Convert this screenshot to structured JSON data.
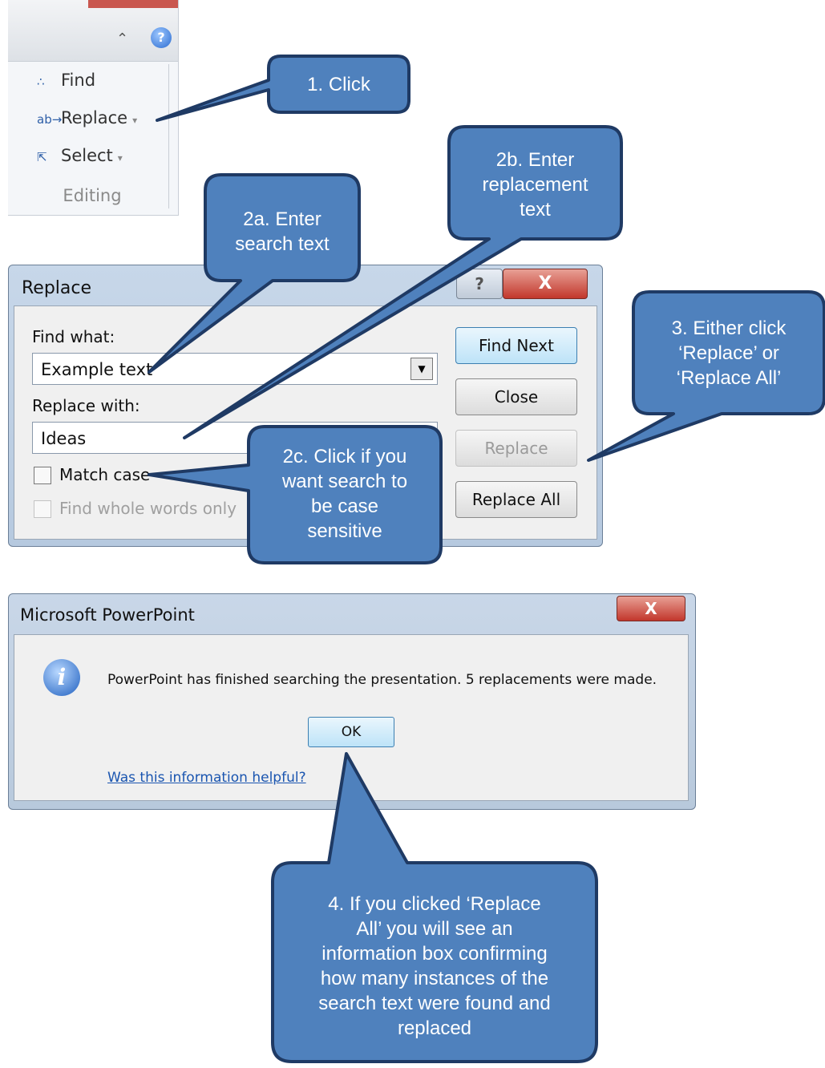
{
  "ribbon": {
    "help_icon": "?",
    "items": [
      {
        "label": "Find",
        "icon": "binoculars-icon",
        "glyph": "∴"
      },
      {
        "label": "Replace",
        "icon": "replace-icon",
        "glyph": "ab→",
        "dropdown": "▾"
      },
      {
        "label": "Select",
        "icon": "cursor-icon",
        "glyph": "⇱",
        "dropdown": "▾"
      }
    ],
    "group_label": "Editing"
  },
  "replace_dialog": {
    "title": "Replace",
    "help_button": "?",
    "close_button": "X",
    "find_what_label": "Find what:",
    "find_what_value": "Example text",
    "replace_with_label": "Replace with:",
    "replace_with_value": "Ideas",
    "match_case_label": "Match case",
    "whole_words_label": "Find whole words only",
    "buttons": {
      "find_next": "Find Next",
      "close": "Close",
      "replace": "Replace",
      "replace_all": "Replace All"
    }
  },
  "message_box": {
    "title": "Microsoft PowerPoint",
    "close_button": "X",
    "info_icon": "i",
    "message": "PowerPoint has finished searching the presentation. 5 replacements were made.",
    "ok_button": "OK",
    "help_link": "Was this information helpful?"
  },
  "callouts": {
    "c1": "1. Click",
    "c2a_line1": "2a. Enter",
    "c2a_line2": "search text",
    "c2b_line1": "2b. Enter",
    "c2b_line2": "replacement",
    "c2b_line3": "text",
    "c3_line1": "3. Either click",
    "c3_line2": "‘Replace’ or",
    "c3_line3": "‘Replace All’",
    "c2c_line1": "2c. Click if you",
    "c2c_line2": "want search to",
    "c2c_line3": "be case",
    "c2c_line4": "sensitive",
    "c4_line1": "4. If you clicked ‘Replace",
    "c4_line2": "All’ you will see an",
    "c4_line3": "information box confirming",
    "c4_line4": "how many instances of the",
    "c4_line5": "search text were found and",
    "c4_line6": "replaced"
  },
  "colors": {
    "callout_fill": "#4f81bd",
    "callout_border": "#1f3a64",
    "dialog_close_red": "#c2372c"
  }
}
